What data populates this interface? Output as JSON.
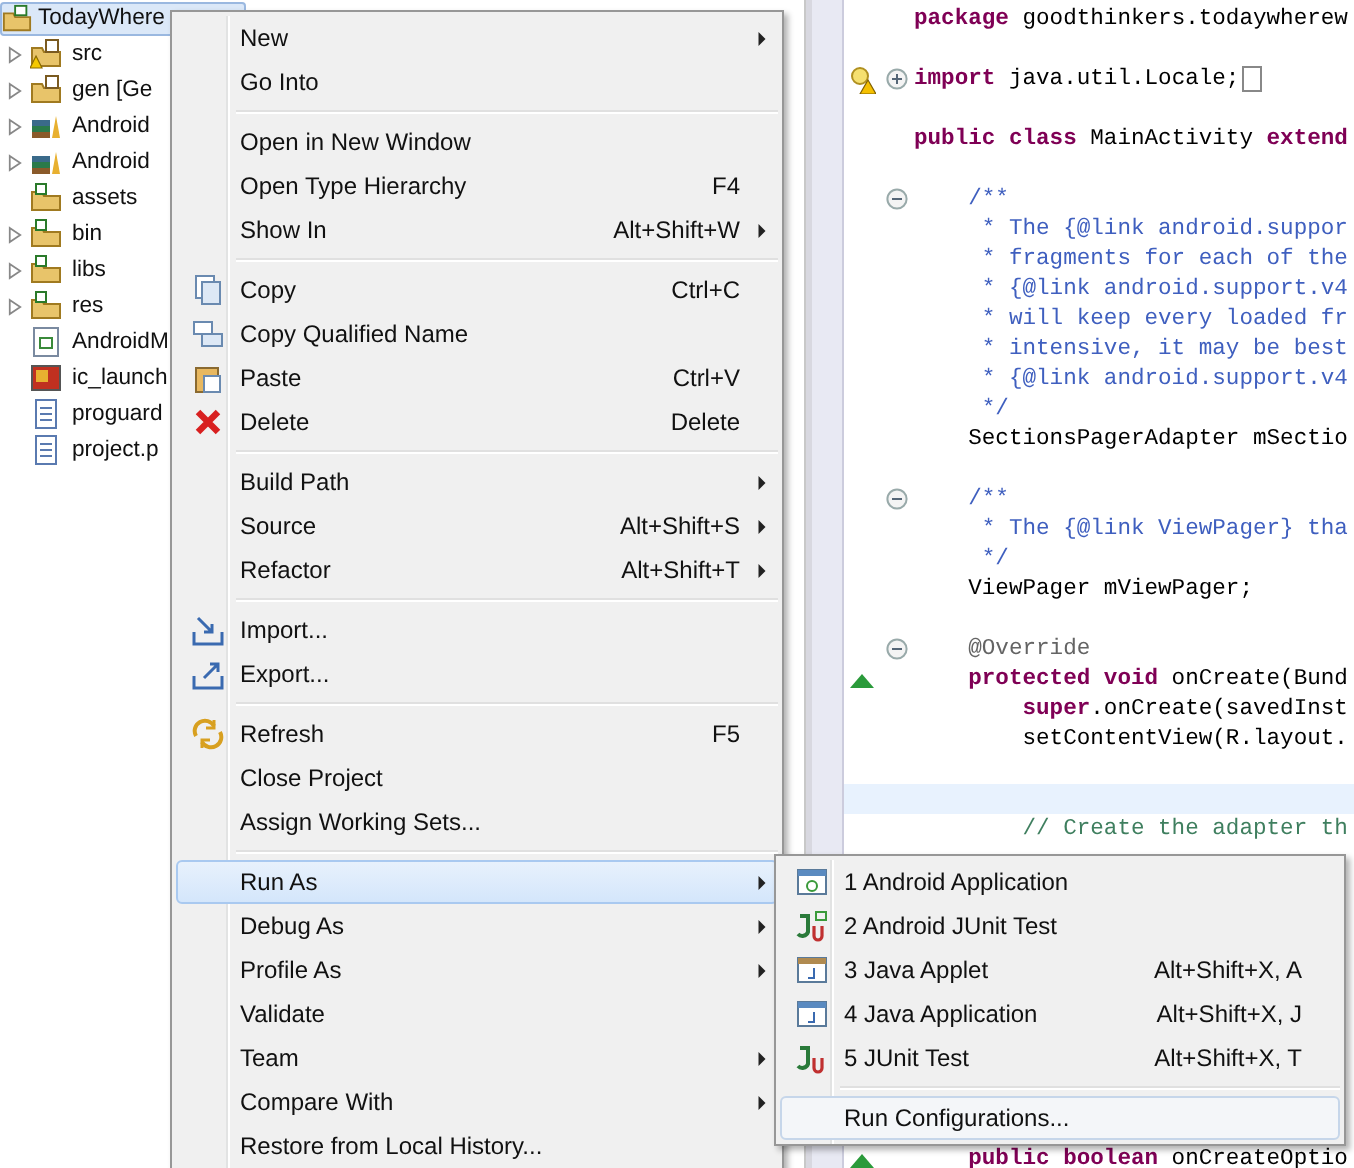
{
  "tree": {
    "label": "TodayWhere",
    "kind": "project",
    "selected": true,
    "children": [
      {
        "label": "src",
        "kind": "source-folder-warning",
        "expanded": false
      },
      {
        "label": "gen [Ge",
        "kind": "source-folder",
        "expanded": false
      },
      {
        "label": "Android",
        "kind": "library",
        "expanded": false
      },
      {
        "label": "Android",
        "kind": "library",
        "expanded": false
      },
      {
        "label": "assets",
        "kind": "folder"
      },
      {
        "label": "bin",
        "kind": "folder",
        "expanded": false
      },
      {
        "label": "libs",
        "kind": "folder",
        "expanded": false
      },
      {
        "label": "res",
        "kind": "folder",
        "expanded": false
      },
      {
        "label": "AndroidM",
        "kind": "manifest"
      },
      {
        "label": "ic_launch",
        "kind": "image"
      },
      {
        "label": "proguard",
        "kind": "text-file"
      },
      {
        "label": "project.p",
        "kind": "text-file"
      }
    ]
  },
  "editor": {
    "lines": [
      {
        "kind": "code",
        "tokens": [
          {
            "text": "package",
            "kind": "keyword"
          },
          {
            "text": " goodthinkers.todaywherew",
            "kind": "plain"
          }
        ]
      },
      {
        "kind": "blank"
      },
      {
        "kind": "code",
        "gutter": [
          {
            "kind": "warning"
          },
          {
            "kind": "fold-collapsed"
          }
        ],
        "tokens": [
          {
            "text": "import",
            "kind": "keyword"
          },
          {
            "text": " java.util.Locale;",
            "kind": "plain"
          },
          {
            "kind": "folded-box"
          }
        ]
      },
      {
        "kind": "blank"
      },
      {
        "kind": "code",
        "tokens": [
          {
            "text": "public class",
            "kind": "keyword"
          },
          {
            "text": " MainActivity ",
            "kind": "plain"
          },
          {
            "text": "extend",
            "kind": "keyword"
          }
        ]
      },
      {
        "kind": "blank"
      },
      {
        "kind": "code",
        "gutter": [
          {
            "kind": "fold-expanded"
          }
        ],
        "tokens": [
          {
            "text": "    /**",
            "kind": "javadoc"
          }
        ]
      },
      {
        "kind": "code",
        "tokens": [
          {
            "text": "     * The {@link android.suppor",
            "kind": "javadoc"
          }
        ]
      },
      {
        "kind": "code",
        "tokens": [
          {
            "text": "     * fragments for each of the",
            "kind": "javadoc"
          }
        ]
      },
      {
        "kind": "code",
        "tokens": [
          {
            "text": "     * {@link android.support.v4",
            "kind": "javadoc"
          }
        ]
      },
      {
        "kind": "code",
        "tokens": [
          {
            "text": "     * will keep every loaded fr",
            "kind": "javadoc"
          }
        ]
      },
      {
        "kind": "code",
        "tokens": [
          {
            "text": "     * intensive, it may be best",
            "kind": "javadoc"
          }
        ]
      },
      {
        "kind": "code",
        "tokens": [
          {
            "text": "     * {@link android.support.v4",
            "kind": "javadoc"
          }
        ]
      },
      {
        "kind": "code",
        "tokens": [
          {
            "text": "     */",
            "kind": "javadoc"
          }
        ]
      },
      {
        "kind": "code",
        "tokens": [
          {
            "text": "    SectionsPagerAdapter mSectio",
            "kind": "plain"
          }
        ]
      },
      {
        "kind": "blank"
      },
      {
        "kind": "code",
        "gutter": [
          {
            "kind": "fold-expanded"
          }
        ],
        "tokens": [
          {
            "text": "    /**",
            "kind": "javadoc"
          }
        ]
      },
      {
        "kind": "code",
        "tokens": [
          {
            "text": "     * The {@link ViewPager} tha",
            "kind": "javadoc"
          }
        ]
      },
      {
        "kind": "code",
        "tokens": [
          {
            "text": "     */",
            "kind": "javadoc"
          }
        ]
      },
      {
        "kind": "code",
        "tokens": [
          {
            "text": "    ViewPager mViewPager;",
            "kind": "plain"
          }
        ]
      },
      {
        "kind": "blank"
      },
      {
        "kind": "code",
        "gutter": [
          {
            "kind": "fold-expanded"
          }
        ],
        "tokens": [
          {
            "text": "    @Override",
            "kind": "annotation"
          }
        ]
      },
      {
        "kind": "code",
        "gutter": [
          {
            "kind": "override"
          }
        ],
        "tokens": [
          {
            "text": "    protected void",
            "kind": "keyword"
          },
          {
            "text": " onCreate(Bund",
            "kind": "plain"
          }
        ]
      },
      {
        "kind": "code",
        "tokens": [
          {
            "text": "        super",
            "kind": "keyword"
          },
          {
            "text": ".onCreate(savedInst",
            "kind": "plain"
          }
        ]
      },
      {
        "kind": "code",
        "tokens": [
          {
            "text": "        setContentView(R.layout.",
            "kind": "plain"
          }
        ]
      },
      {
        "kind": "blank"
      },
      {
        "kind": "current"
      },
      {
        "kind": "code",
        "tokens": [
          {
            "text": "        // Create the adapter th",
            "kind": "comment"
          }
        ]
      },
      {
        "kind": "blank"
      },
      {
        "kind": "blank"
      },
      {
        "kind": "blank"
      },
      {
        "kind": "blank"
      },
      {
        "kind": "blank"
      },
      {
        "kind": "blank"
      },
      {
        "kind": "blank"
      },
      {
        "kind": "blank"
      },
      {
        "kind": "blank"
      },
      {
        "kind": "blank"
      },
      {
        "kind": "code",
        "gutter": [
          {
            "kind": "override"
          }
        ],
        "tokens": [
          {
            "text": "    public boolean",
            "kind": "keyword"
          },
          {
            "text": " onCreateOptio",
            "kind": "plain"
          }
        ]
      }
    ]
  },
  "context_menu": {
    "groups": [
      {
        "items": [
          {
            "label": "New",
            "submenu": true,
            "selected": false
          },
          {
            "label": "Go Into",
            "selected": false
          }
        ]
      },
      {
        "items": [
          {
            "label": "Open in New Window",
            "selected": false
          },
          {
            "label": "Open Type Hierarchy",
            "shortcut": "F4",
            "selected": false
          },
          {
            "label": "Show In",
            "shortcut": "Alt+Shift+W",
            "submenu": true,
            "selected": false
          }
        ]
      },
      {
        "items": [
          {
            "label": "Copy",
            "shortcut": "Ctrl+C",
            "kind": "copy",
            "selected": false
          },
          {
            "label": "Copy Qualified Name",
            "kind": "copy-qualified",
            "selected": false
          },
          {
            "label": "Paste",
            "shortcut": "Ctrl+V",
            "kind": "paste",
            "selected": false
          },
          {
            "label": "Delete",
            "shortcut": "Delete",
            "kind": "delete",
            "selected": false
          }
        ]
      },
      {
        "items": [
          {
            "label": "Build Path",
            "submenu": true,
            "selected": false
          },
          {
            "label": "Source",
            "shortcut": "Alt+Shift+S",
            "submenu": true,
            "selected": false
          },
          {
            "label": "Refactor",
            "shortcut": "Alt+Shift+T",
            "submenu": true,
            "selected": false
          }
        ]
      },
      {
        "items": [
          {
            "label": "Import...",
            "kind": "import",
            "selected": false
          },
          {
            "label": "Export...",
            "kind": "export",
            "selected": false
          }
        ]
      },
      {
        "items": [
          {
            "label": "Refresh",
            "shortcut": "F5",
            "kind": "refresh",
            "selected": false
          },
          {
            "label": "Close Project",
            "selected": false
          },
          {
            "label": "Assign Working Sets...",
            "selected": false
          }
        ]
      },
      {
        "items": [
          {
            "label": "Run As",
            "submenu": true,
            "selected": true
          },
          {
            "label": "Debug As",
            "submenu": true,
            "selected": false
          },
          {
            "label": "Profile As",
            "submenu": true,
            "selected": false
          },
          {
            "label": "Validate",
            "selected": false
          },
          {
            "label": "Team",
            "submenu": true,
            "selected": false
          },
          {
            "label": "Compare With",
            "submenu": true,
            "selected": false
          },
          {
            "label": "Restore from Local History...",
            "selected": false
          }
        ]
      }
    ]
  },
  "run_as_submenu": {
    "groups": [
      {
        "items": [
          {
            "label": "1 Android Application",
            "kind": "android-app",
            "selected": false
          },
          {
            "label": "2 Android JUnit Test",
            "kind": "android-junit",
            "selected": false
          },
          {
            "label": "3 Java Applet",
            "shortcut": "Alt+Shift+X, A",
            "kind": "applet",
            "selected": false
          },
          {
            "label": "4 Java Application",
            "shortcut": "Alt+Shift+X, J",
            "kind": "java-app",
            "selected": false
          },
          {
            "label": "5 JUnit Test",
            "shortcut": "Alt+Shift+X, T",
            "kind": "junit",
            "selected": false
          }
        ]
      },
      {
        "items": [
          {
            "label": "Run Configurations...",
            "selected": true
          }
        ]
      }
    ]
  }
}
